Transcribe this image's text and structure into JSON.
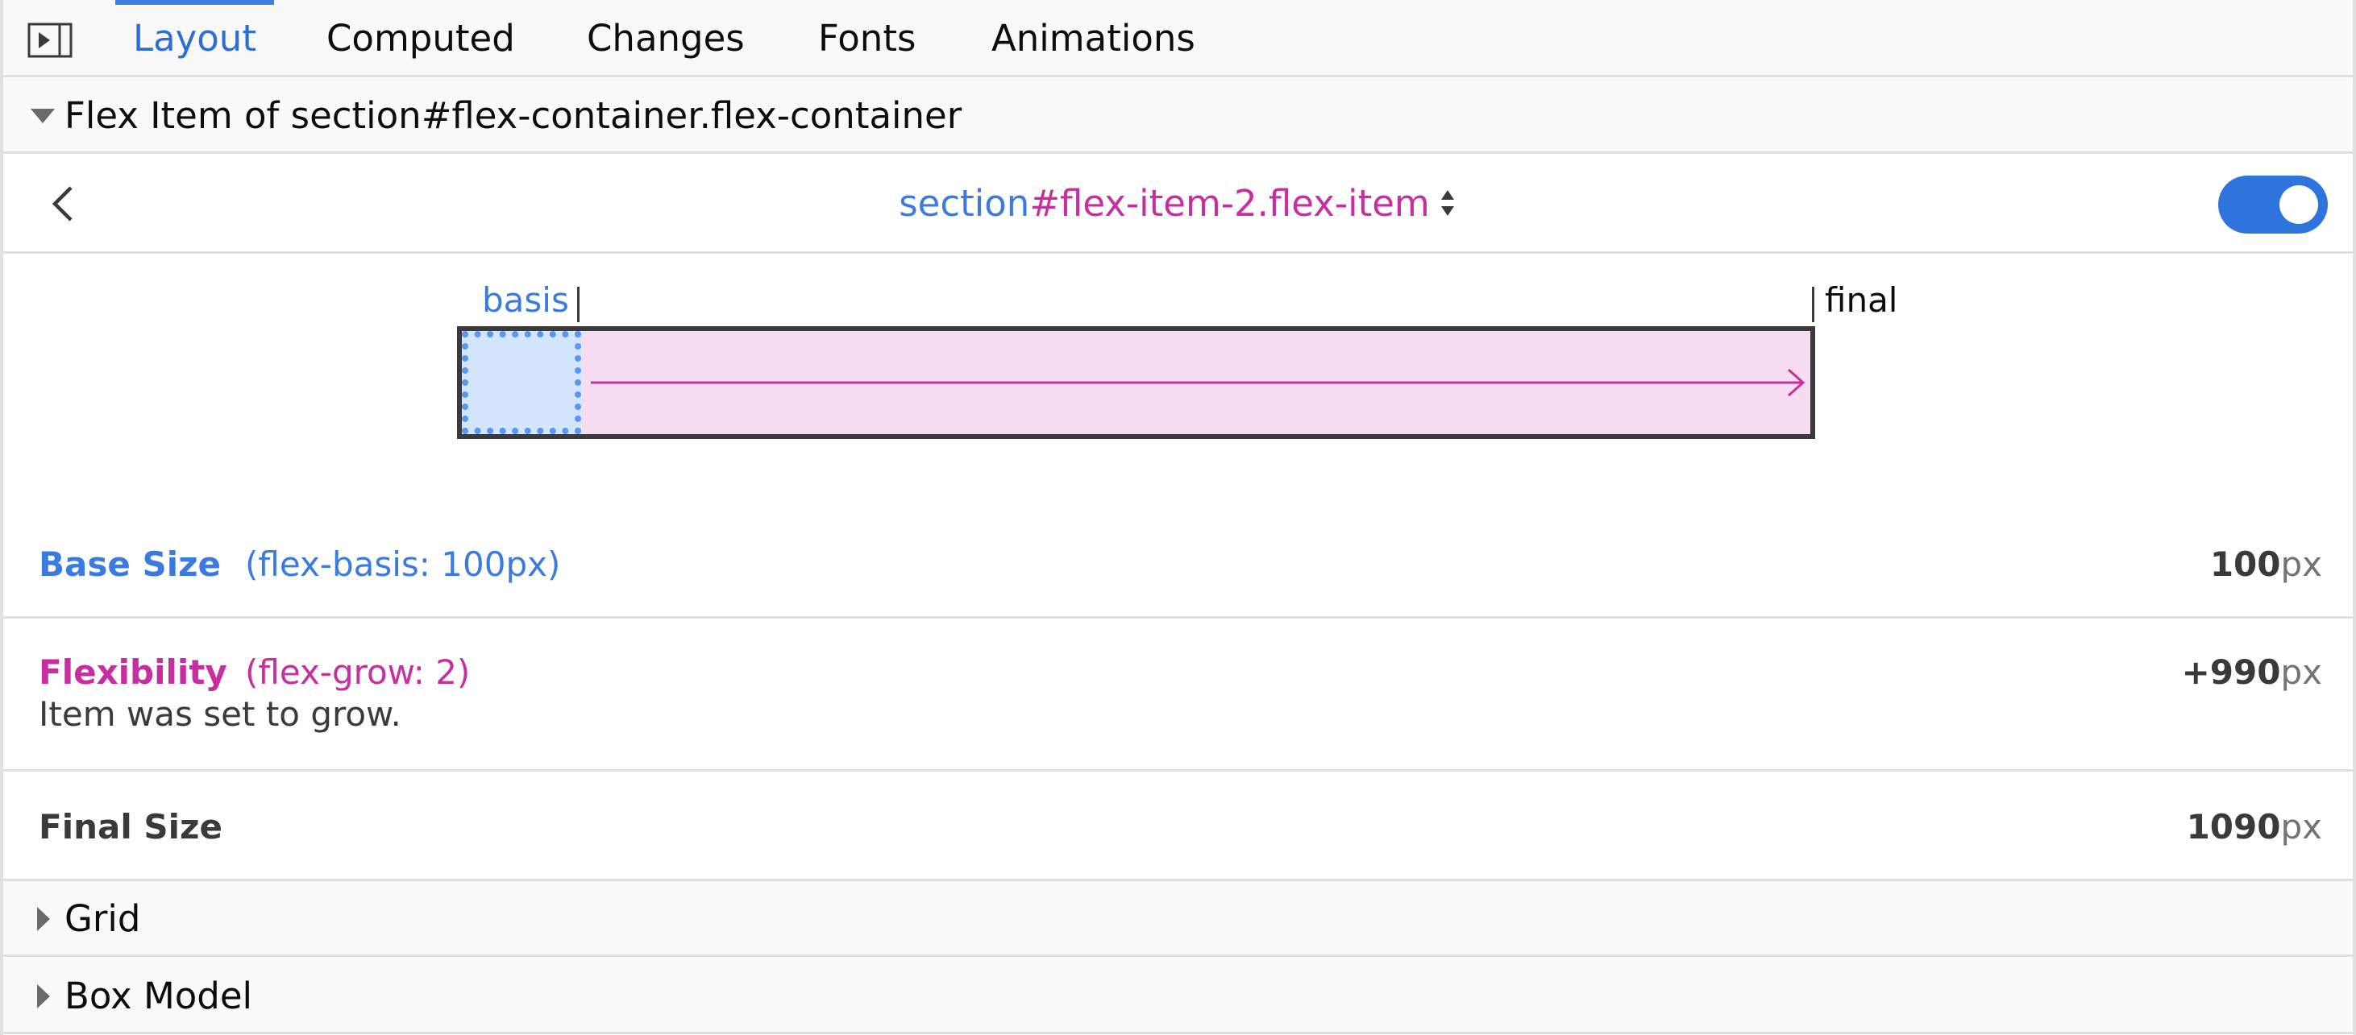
{
  "tabs": [
    {
      "label": "Layout",
      "active": true
    },
    {
      "label": "Computed",
      "active": false
    },
    {
      "label": "Changes",
      "active": false
    },
    {
      "label": "Fonts",
      "active": false
    },
    {
      "label": "Animations",
      "active": false
    }
  ],
  "flex_section": {
    "title": "Flex Item of section#flex-container.flex-container",
    "expanded": true
  },
  "selector_row": {
    "selector_tag": "section",
    "selector_rest": "#flex-item-2.flex-item",
    "highlight_toggle_on": true
  },
  "diagram": {
    "basis_label": "basis",
    "final_label": "final"
  },
  "base_size": {
    "label": "Base Size",
    "note": "(flex-basis: 100px)",
    "value": "100",
    "unit": "px"
  },
  "flexibility": {
    "label": "Flexibility",
    "note": "(flex-grow: 2)",
    "value": "+990",
    "unit": "px",
    "description": "Item was set to grow."
  },
  "final_size": {
    "label": "Final Size",
    "value": "1090",
    "unit": "px"
  },
  "grid_section": {
    "title": "Grid",
    "expanded": false
  },
  "box_model_section": {
    "title": "Box Model",
    "expanded": false
  },
  "colors": {
    "accent_blue": "#3b7be0",
    "flex_magenta": "#c72ea0",
    "basis_fill": "#d3e5fc",
    "grow_fill": "#f6dcf1"
  }
}
